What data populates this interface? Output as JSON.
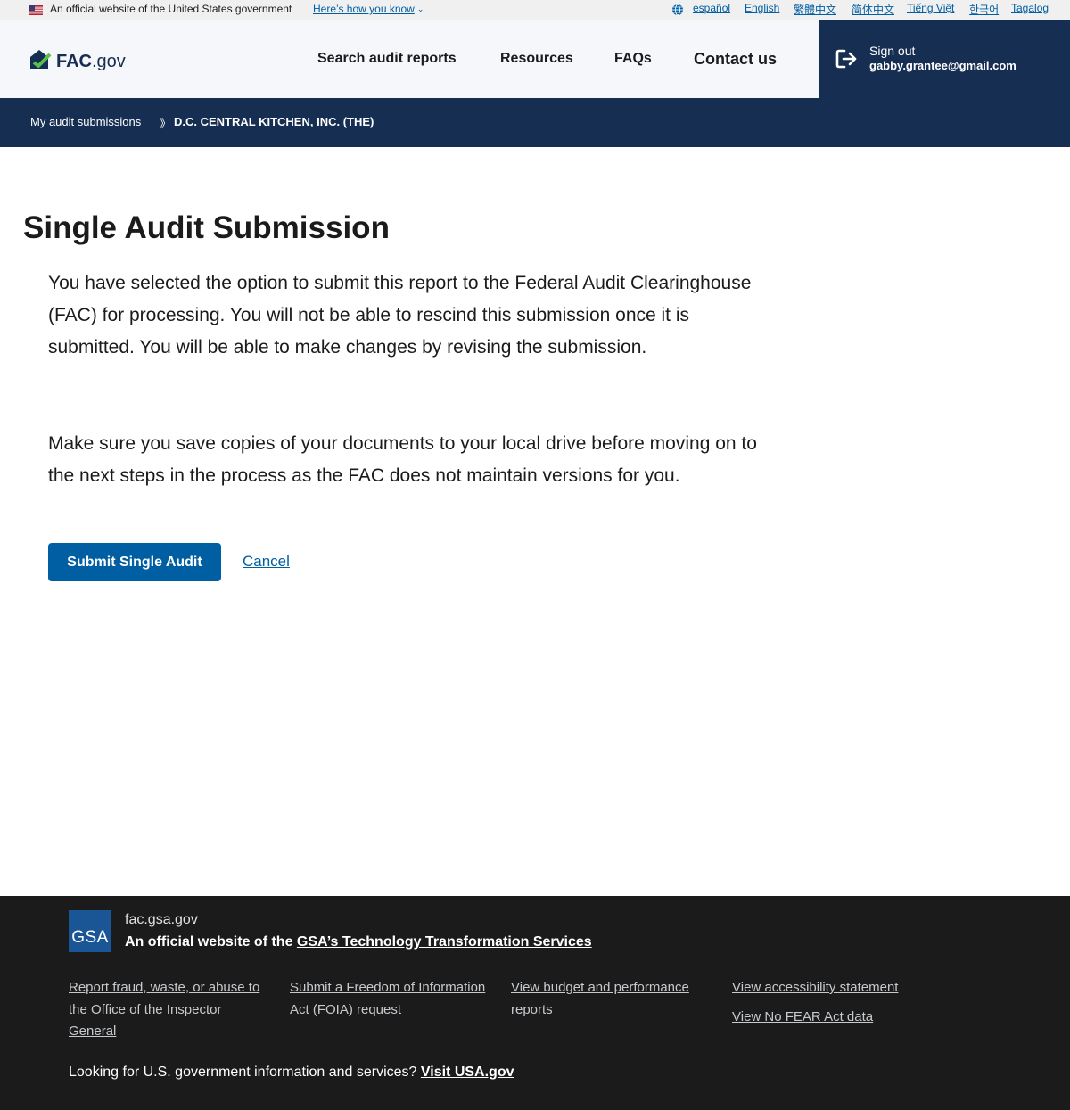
{
  "gov_banner": {
    "official_text": "An official website of the United States government",
    "how_you_know": "Here’s how you know",
    "languages": [
      "español",
      "English",
      "繁體中文",
      "简体中文",
      "Tiếng Việt",
      "한국어",
      "Tagalog"
    ]
  },
  "header": {
    "logo_bold": "FAC",
    "logo_suffix": ".gov",
    "nav": [
      "Search audit reports",
      "Resources",
      "FAQs",
      "Contact us"
    ],
    "signout_label": "Sign out",
    "user_email": "gabby.grantee@gmail.com"
  },
  "breadcrumb": {
    "link": "My audit submissions",
    "separator": "》",
    "current": "D.C. CENTRAL KITCHEN, INC. (THE)"
  },
  "main": {
    "title": "Single Audit Submission",
    "paragraph1": "You have selected the option to submit this report to the Federal Audit Clearinghouse (FAC) for processing. You will not be able to rescind this submission once it is submitted. You will be able to make changes by revising the submission.",
    "paragraph2": "Make sure you save copies of your documents to your local drive before moving on to the next steps in the process as the FAC does not maintain versions for you.",
    "submit_label": "Submit Single Audit",
    "cancel_label": "Cancel"
  },
  "footer": {
    "gsa_logo_text": "GSA",
    "site_url": "fac.gsa.gov",
    "official_prefix": "An official website of the ",
    "official_link": "GSA’s Technology Transformation Services",
    "links": [
      "Report fraud, waste, or abuse to the Office of the Inspector General",
      "Submit a Freedom of Information Act (FOIA) request",
      "View budget and performance reports",
      "View accessibility statement",
      "View No FEAR Act data"
    ],
    "looking_text": "Looking for U.S. government information and services? ",
    "looking_link": "Visit USA.gov"
  },
  "colors": {
    "primary": "#005ea2",
    "navy": "#162e51",
    "footer_bg": "#1b1b1b",
    "header_bg": "#f5f7fa"
  }
}
